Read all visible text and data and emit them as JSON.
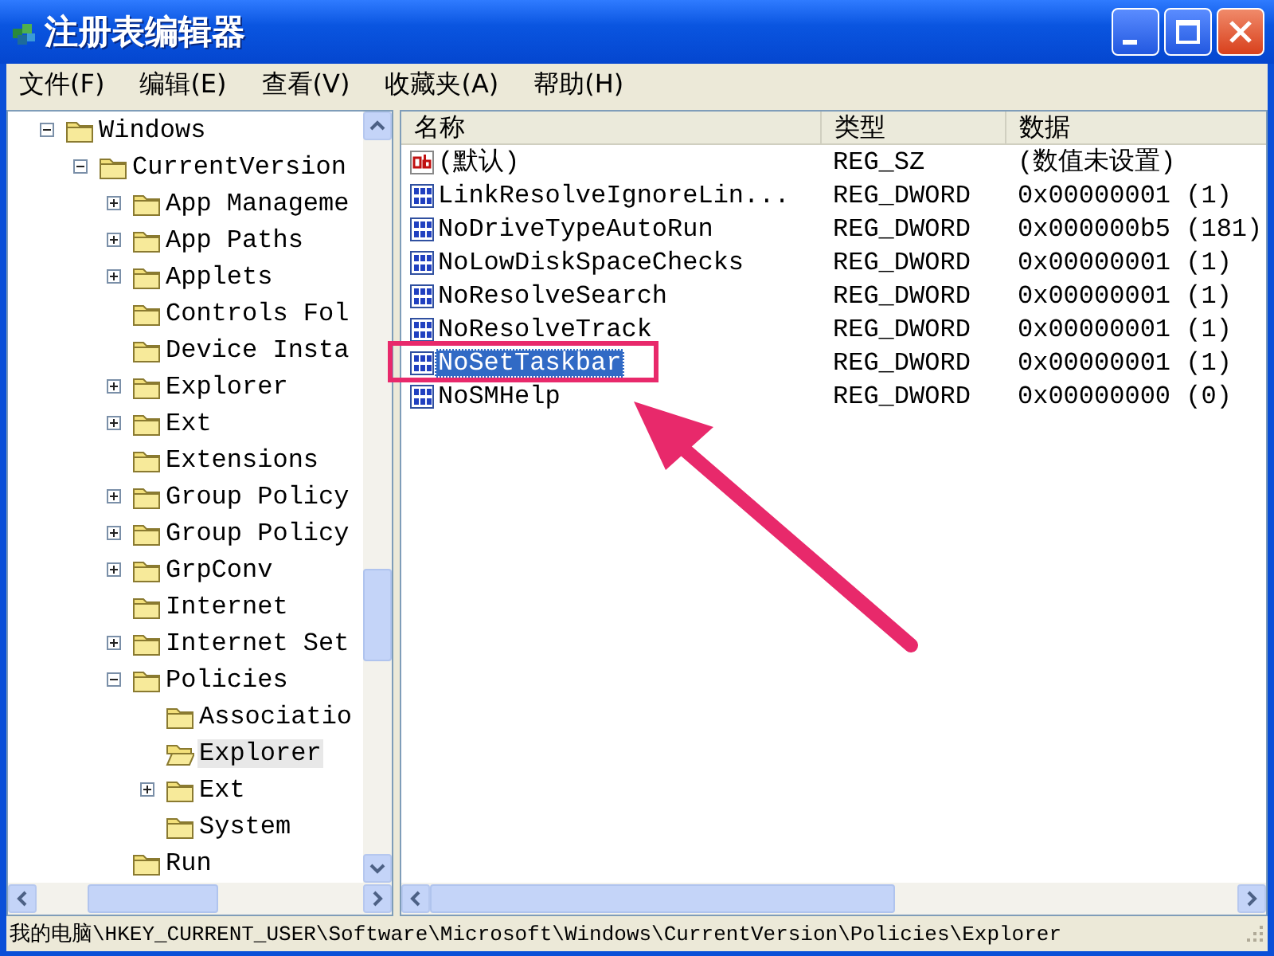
{
  "window": {
    "title": "注册表编辑器"
  },
  "menu": [
    {
      "label": "文件(F)"
    },
    {
      "label": "编辑(E)"
    },
    {
      "label": "查看(V)"
    },
    {
      "label": "收藏夹(A)"
    },
    {
      "label": "帮助(H)"
    }
  ],
  "tree": {
    "items": [
      {
        "label": "Windows",
        "kind": "expanded",
        "selected": false,
        "children": [
          {
            "label": "CurrentVersion",
            "kind": "expanded",
            "selected": false,
            "children": [
              {
                "label": "App Manageme",
                "kind": "collapsed",
                "selected": false
              },
              {
                "label": "App Paths",
                "kind": "collapsed",
                "selected": false
              },
              {
                "label": "Applets",
                "kind": "collapsed",
                "selected": false
              },
              {
                "label": "Controls Fol",
                "kind": "leaf",
                "selected": false
              },
              {
                "label": "Device Insta",
                "kind": "leaf",
                "selected": false
              },
              {
                "label": "Explorer",
                "kind": "collapsed",
                "selected": false
              },
              {
                "label": "Ext",
                "kind": "collapsed",
                "selected": false
              },
              {
                "label": "Extensions",
                "kind": "leaf",
                "selected": false
              },
              {
                "label": "Group Policy",
                "kind": "collapsed",
                "selected": false
              },
              {
                "label": "Group Policy",
                "kind": "collapsed",
                "selected": false
              },
              {
                "label": "GrpConv",
                "kind": "collapsed",
                "selected": false
              },
              {
                "label": "Internet",
                "kind": "leaf",
                "selected": false
              },
              {
                "label": "Internet Set",
                "kind": "collapsed",
                "selected": false
              },
              {
                "label": "Policies",
                "kind": "expanded",
                "selected": false,
                "children": [
                  {
                    "label": "Associatio",
                    "kind": "leaf",
                    "selected": false
                  },
                  {
                    "label": "Explorer",
                    "kind": "leaf",
                    "selected": true
                  },
                  {
                    "label": "Ext",
                    "kind": "collapsed",
                    "selected": false
                  },
                  {
                    "label": "System",
                    "kind": "leaf",
                    "selected": false
                  }
                ]
              },
              {
                "label": "Run",
                "kind": "leaf",
                "selected": false
              }
            ]
          }
        ]
      }
    ]
  },
  "list": {
    "columns": [
      "名称",
      "类型",
      "数据"
    ],
    "rows": [
      {
        "name": "(默认)",
        "kind": "string",
        "type": "REG_SZ",
        "data": "(数值未设置)",
        "selected": false
      },
      {
        "name": "LinkResolveIgnoreLin...",
        "kind": "dword",
        "type": "REG_DWORD",
        "data": "0x00000001 (1)",
        "selected": false
      },
      {
        "name": "NoDriveTypeAutoRun",
        "kind": "dword",
        "type": "REG_DWORD",
        "data": "0x000000b5 (181)",
        "selected": false
      },
      {
        "name": "NoLowDiskSpaceChecks",
        "kind": "dword",
        "type": "REG_DWORD",
        "data": "0x00000001 (1)",
        "selected": false
      },
      {
        "name": "NoResolveSearch",
        "kind": "dword",
        "type": "REG_DWORD",
        "data": "0x00000001 (1)",
        "selected": false
      },
      {
        "name": "NoResolveTrack",
        "kind": "dword",
        "type": "REG_DWORD",
        "data": "0x00000001 (1)",
        "selected": false
      },
      {
        "name": "NoSetTaskbar",
        "kind": "dword",
        "type": "REG_DWORD",
        "data": "0x00000001 (1)",
        "selected": true
      },
      {
        "name": "NoSMHelp",
        "kind": "dword",
        "type": "REG_DWORD",
        "data": "0x00000000 (0)",
        "selected": false
      }
    ]
  },
  "status_bar": "我的电脑\\HKEY_CURRENT_USER\\Software\\Microsoft\\Windows\\CurrentVersion\\Policies\\Explorer"
}
